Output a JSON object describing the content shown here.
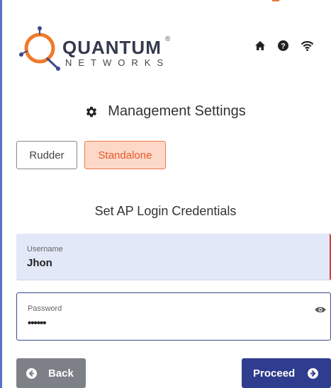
{
  "header": {
    "brand": {
      "name": "QUANTUM",
      "registered": "®",
      "tagline": "NETWORKS"
    },
    "icons": [
      "home-icon",
      "help-icon",
      "wifi-icon"
    ]
  },
  "section": {
    "title": "Management Settings",
    "icon": "gear-icon"
  },
  "mode": {
    "options": [
      {
        "label": "Rudder",
        "selected": false
      },
      {
        "label": "Standalone",
        "selected": true
      }
    ]
  },
  "credentials": {
    "title": "Set AP Login Credentials",
    "username": {
      "label": "Username",
      "value": "Jhon"
    },
    "password": {
      "label": "Password",
      "value": "••••••"
    }
  },
  "actions": {
    "back_label": "Back",
    "proceed_label": "Proceed"
  },
  "colors": {
    "accent": "#2f3d8e",
    "selected_fill": "#fbd8c8",
    "selected_text": "#e85a2a",
    "back_button": "#7e8087",
    "logo_orange": "#f07a2a"
  }
}
